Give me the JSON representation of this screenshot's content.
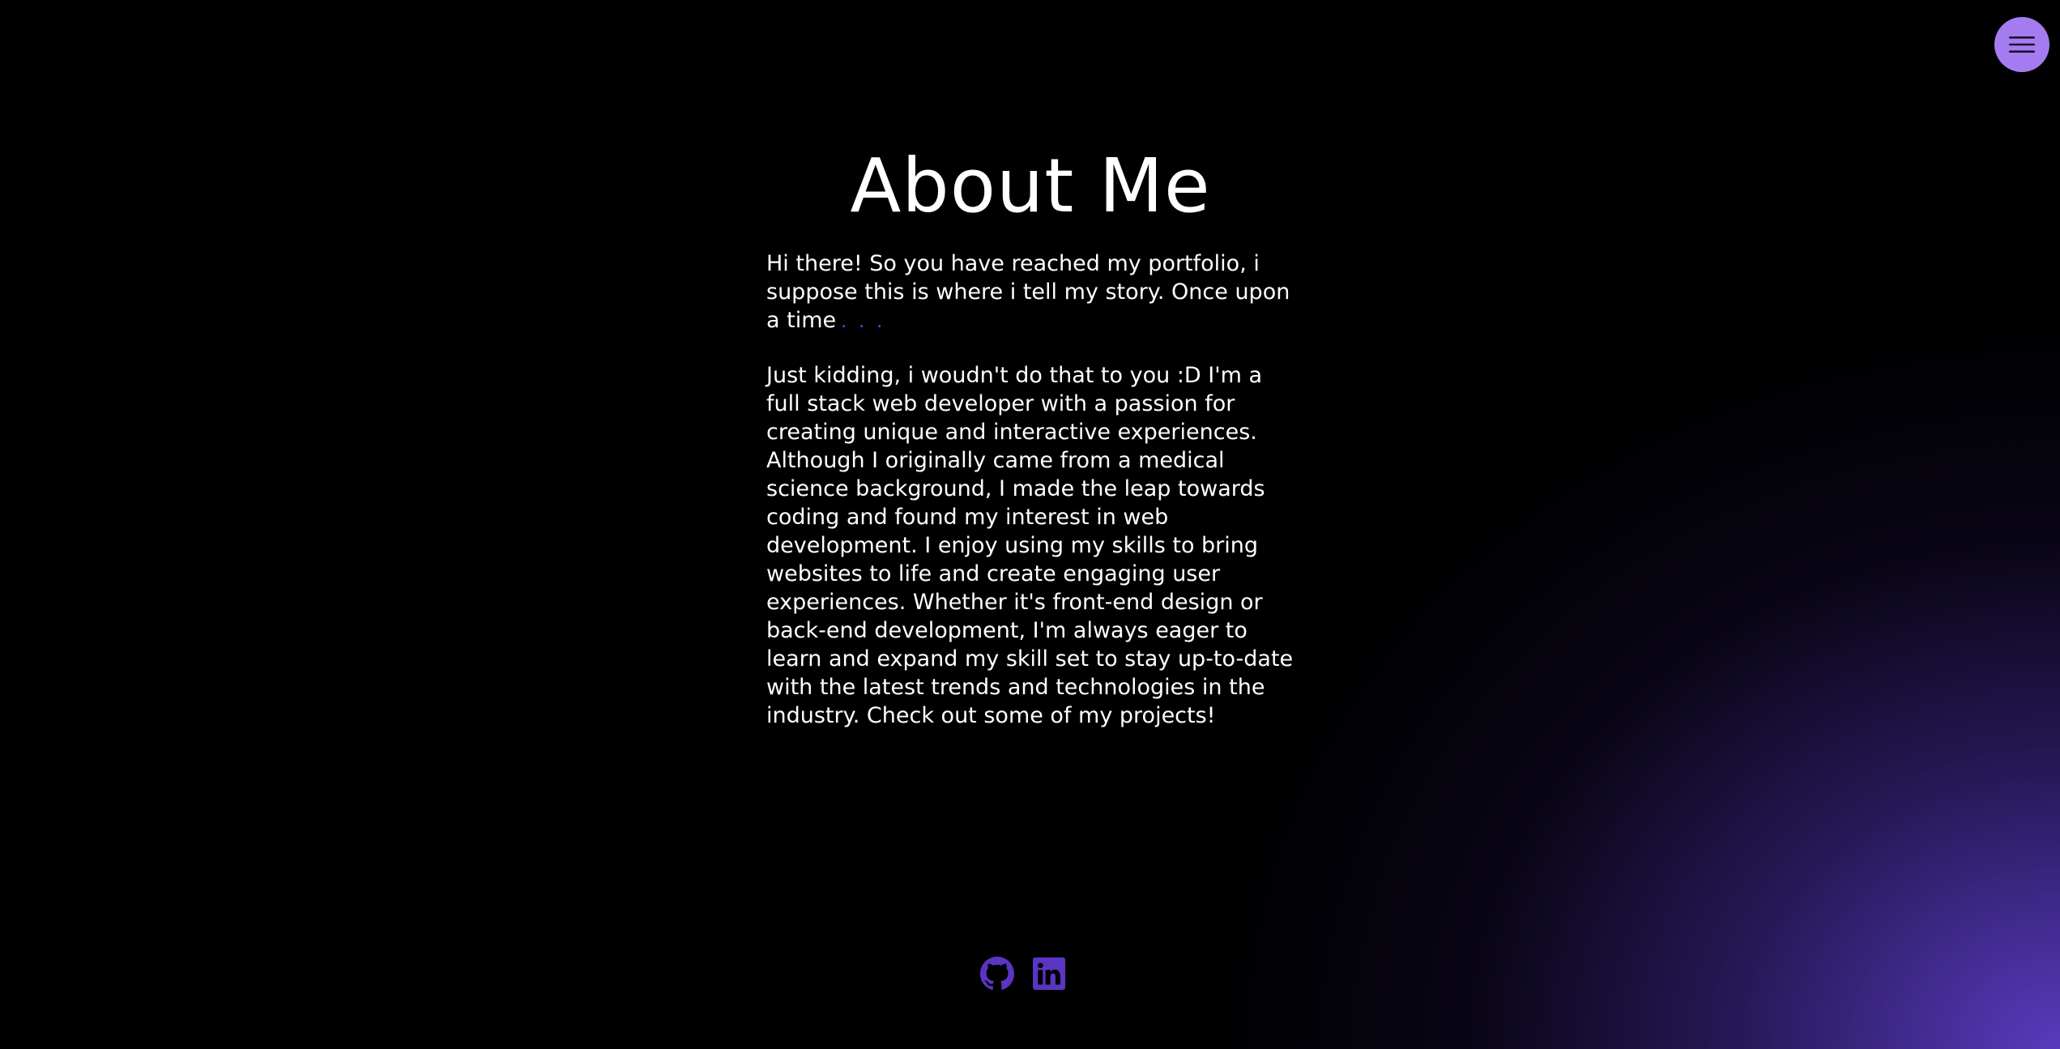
{
  "menu": {
    "icon": "hamburger-menu-icon",
    "color": "#a57cf0"
  },
  "about": {
    "title": "About Me",
    "intro": "Hi there! So you have reached my portfolio, i suppose this is where i tell my story. Once upon a time",
    "intro_ellipsis": ". . .",
    "body": "Just kidding, i woudn't do that to you :D I'm a full stack web developer with a passion for creating unique and interactive experiences. Although I originally came from a medical science background, I made the leap towards coding and found my interest in web development. I enjoy using my skills to bring websites to life and create engaging user experiences. Whether it's front-end design or back-end development, I'm always eager to learn and expand my skill set to stay up-to-date with the latest trends and technologies in the industry. Check out some of my projects!"
  },
  "socials": [
    {
      "icon": "github-icon"
    },
    {
      "icon": "linkedin-icon"
    }
  ],
  "colors": {
    "background": "#000000",
    "accent": "#a57cf0",
    "social_icon": "#5b35c2",
    "ellipsis": "#4b55ff",
    "text": "#ffffff"
  }
}
